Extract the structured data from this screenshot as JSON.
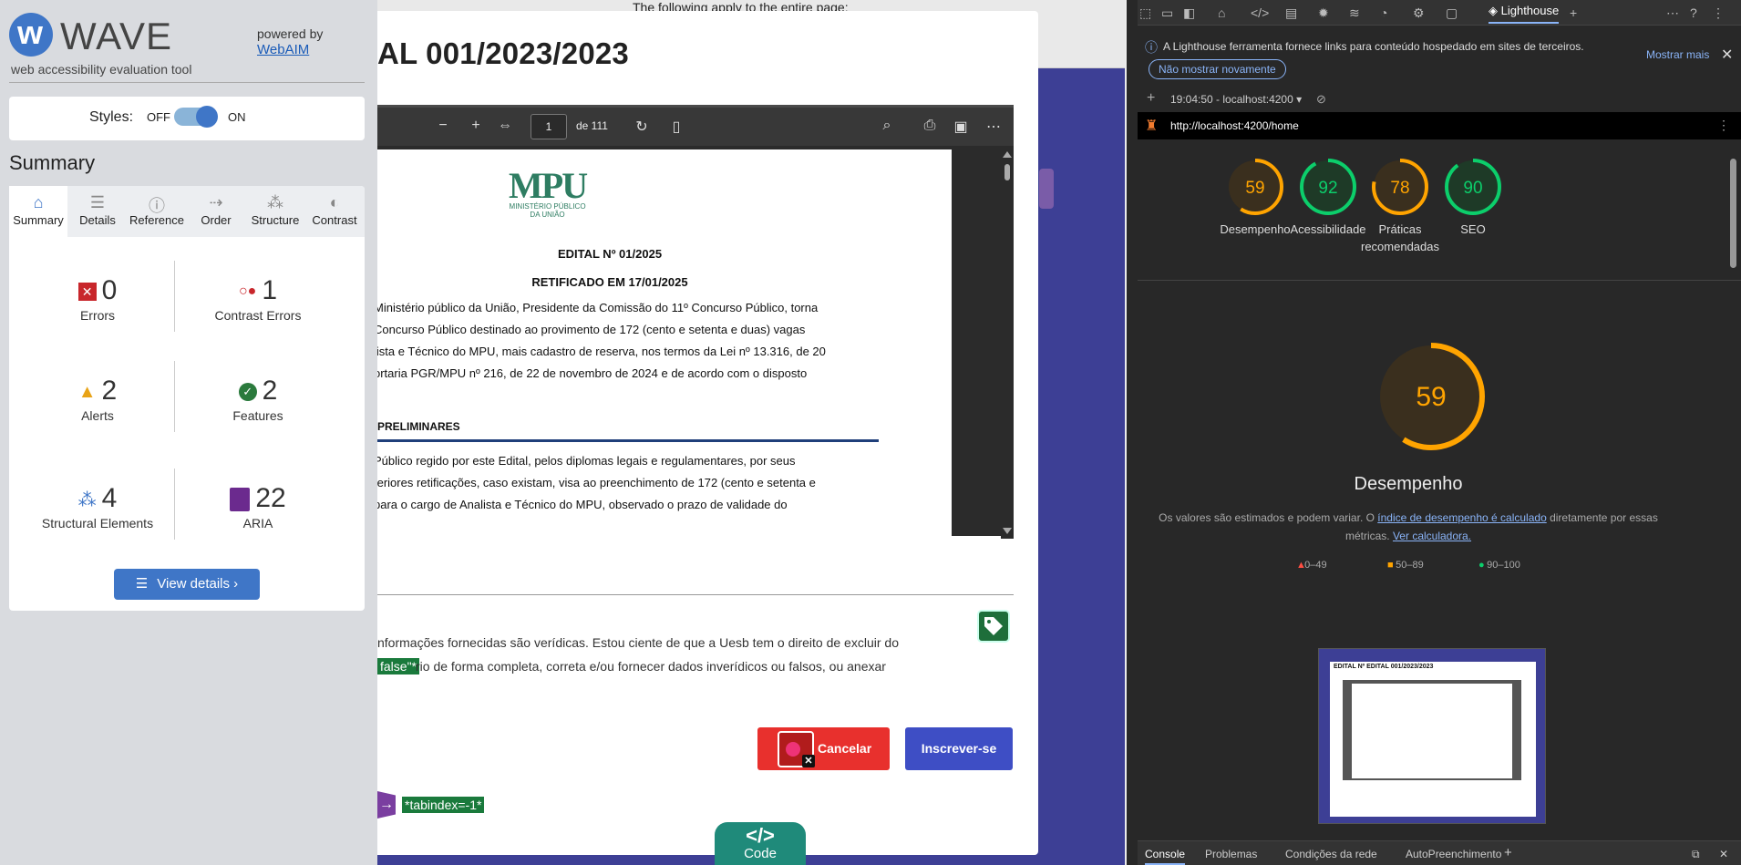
{
  "page": {
    "top_text": "The following apply to the entire page:",
    "modal_title": "AL 001/2023/2023",
    "pdf": {
      "page_number": "1",
      "page_total": "de 111",
      "logo_big": "MPU",
      "logo_small_1": "MINISTÉRIO PÚBLICO",
      "logo_small_2": "DA UNIÃO",
      "heading1": "EDITAL Nº 01/2025",
      "heading2": "RETIFICADO EM 17/01/2025",
      "p1_lines": [
        "Ministério público da União, Presidente da Comissão do 11º Concurso Público, torna",
        " Concurso Público destinado ao provimento de 172 (cento e setenta e duas) vagas",
        "lista e Técnico do MPU, mais cadastro de reserva, nos termos da Lei nº 13.316, de 20",
        "ortaria PGR/MPU nº 216, de 22 de novembro de 2024 e de acordo com o disposto"
      ],
      "section": "PRELIMINARES",
      "p2_lines": [
        "Público regido por este Edital, pelos diplomas legais e regulamentares, por seus",
        "teriores retificações, caso existam, visa ao preenchimento de 172 (cento e setenta e",
        "para o cargo de Analista e Técnico do MPU, observado o prazo de validade do"
      ]
    },
    "decl_line1": "nformações fornecidas são verídicas. Estou ciente de que a Uesb tem o direito de excluir do",
    "false_badge": "false\"*",
    "decl_line2": "rio de forma completa, correta e/ou fornecer dados inverídicos ou falsos, ou anexar",
    "cancel_label": "Cancelar",
    "submit_label": "Inscrever-se",
    "tabindex_badge": "*tabindex=-1*",
    "code_glyph": "</>",
    "code_label": "Code"
  },
  "wave": {
    "name": "WAVE",
    "subtitle": "web accessibility evaluation tool",
    "powered_by": "powered by",
    "webaim": "WebAIM",
    "styles_label": "Styles:",
    "styles_off": "OFF",
    "styles_on": "ON",
    "styles_state": "on",
    "summary_heading": "Summary",
    "tabs": [
      "Summary",
      "Details",
      "Reference",
      "Order",
      "Structure",
      "Contrast"
    ],
    "tab_icons": [
      "home-icon",
      "list-icon",
      "info-icon",
      "order-icon",
      "structure-icon",
      "contrast-icon"
    ],
    "stats": [
      {
        "count": "0",
        "label": "Errors",
        "icon": "error-icon",
        "color": "#c8262b"
      },
      {
        "count": "1",
        "label": "Contrast Errors",
        "icon": "contrast-error-icon",
        "color": "#c8262b"
      },
      {
        "count": "2",
        "label": "Alerts",
        "icon": "alert-icon",
        "color": "#e8a317"
      },
      {
        "count": "2",
        "label": "Features",
        "icon": "feature-icon",
        "color": "#2b7a3d"
      },
      {
        "count": "4",
        "label": "Structural Elements",
        "icon": "structure-icon",
        "color": "#3f76c7"
      },
      {
        "count": "22",
        "label": "ARIA",
        "icon": "aria-icon",
        "color": "#6b2a8e"
      }
    ],
    "view_details": "View details ›"
  },
  "devtools": {
    "active_tab": "Lighthouse",
    "info_text": "A Lighthouse ferramenta fornece links para conteúdo hospedado em sites de terceiros.",
    "show_more": "Mostrar mais",
    "dont_show": "Não mostrar novamente",
    "report_label": "19:04:50 - localhost:4200",
    "url": "http://localhost:4200/home",
    "scores": [
      {
        "value": "59",
        "label": "Desempenho",
        "color": "#ffa400"
      },
      {
        "value": "92",
        "label": "Acessibilidade",
        "color": "#0cce6b"
      },
      {
        "value": "78",
        "label": "Práticas recomendadas",
        "color": "#ffa400"
      },
      {
        "value": "90",
        "label": "SEO",
        "color": "#0cce6b"
      }
    ],
    "big_score": "59",
    "big_label": "Desempenho",
    "desc_pre": "Os valores são estimados e podem variar. O ",
    "desc_link1": "índice de desempenho é calculado",
    "desc_mid": " diretamente por essas métricas. ",
    "desc_link2": "Ver calculadora.",
    "legend": [
      "0–49",
      "50–89",
      "90–100"
    ],
    "legend_colors": [
      "#ff4e42",
      "#ffa400",
      "#0cce6b"
    ],
    "screenshot_title": "EDITAL Nº EDITAL 001/2023/2023",
    "bottom_tabs": [
      "Console",
      "Problemas",
      "Condições da rede",
      "AutoPreenchimento"
    ]
  }
}
